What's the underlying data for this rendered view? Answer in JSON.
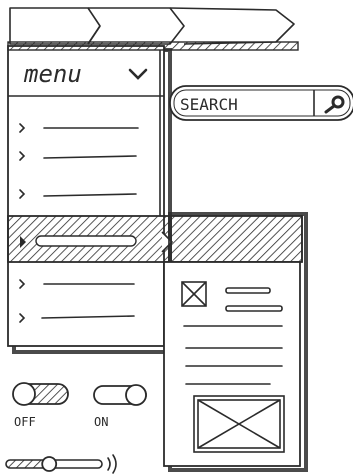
{
  "menu": {
    "title": "menu",
    "items_before_selected": 3,
    "selected_index": 3,
    "items_after_selected": 2
  },
  "search": {
    "label": "SEARCH"
  },
  "toggles": [
    {
      "label": "OFF",
      "state": "off"
    },
    {
      "label": "ON",
      "state": "on"
    }
  ],
  "volume_slider": {
    "level_fraction": 0.45
  },
  "icons": {
    "dropdown": "chevron-down-icon",
    "search": "magnifier-icon",
    "menu_item": "chevron-right-icon",
    "image": "image-placeholder-icon",
    "volume": "speaker-waves-icon"
  },
  "colors": {
    "ink": "#2b2b2b",
    "paper": "#ffffff"
  }
}
